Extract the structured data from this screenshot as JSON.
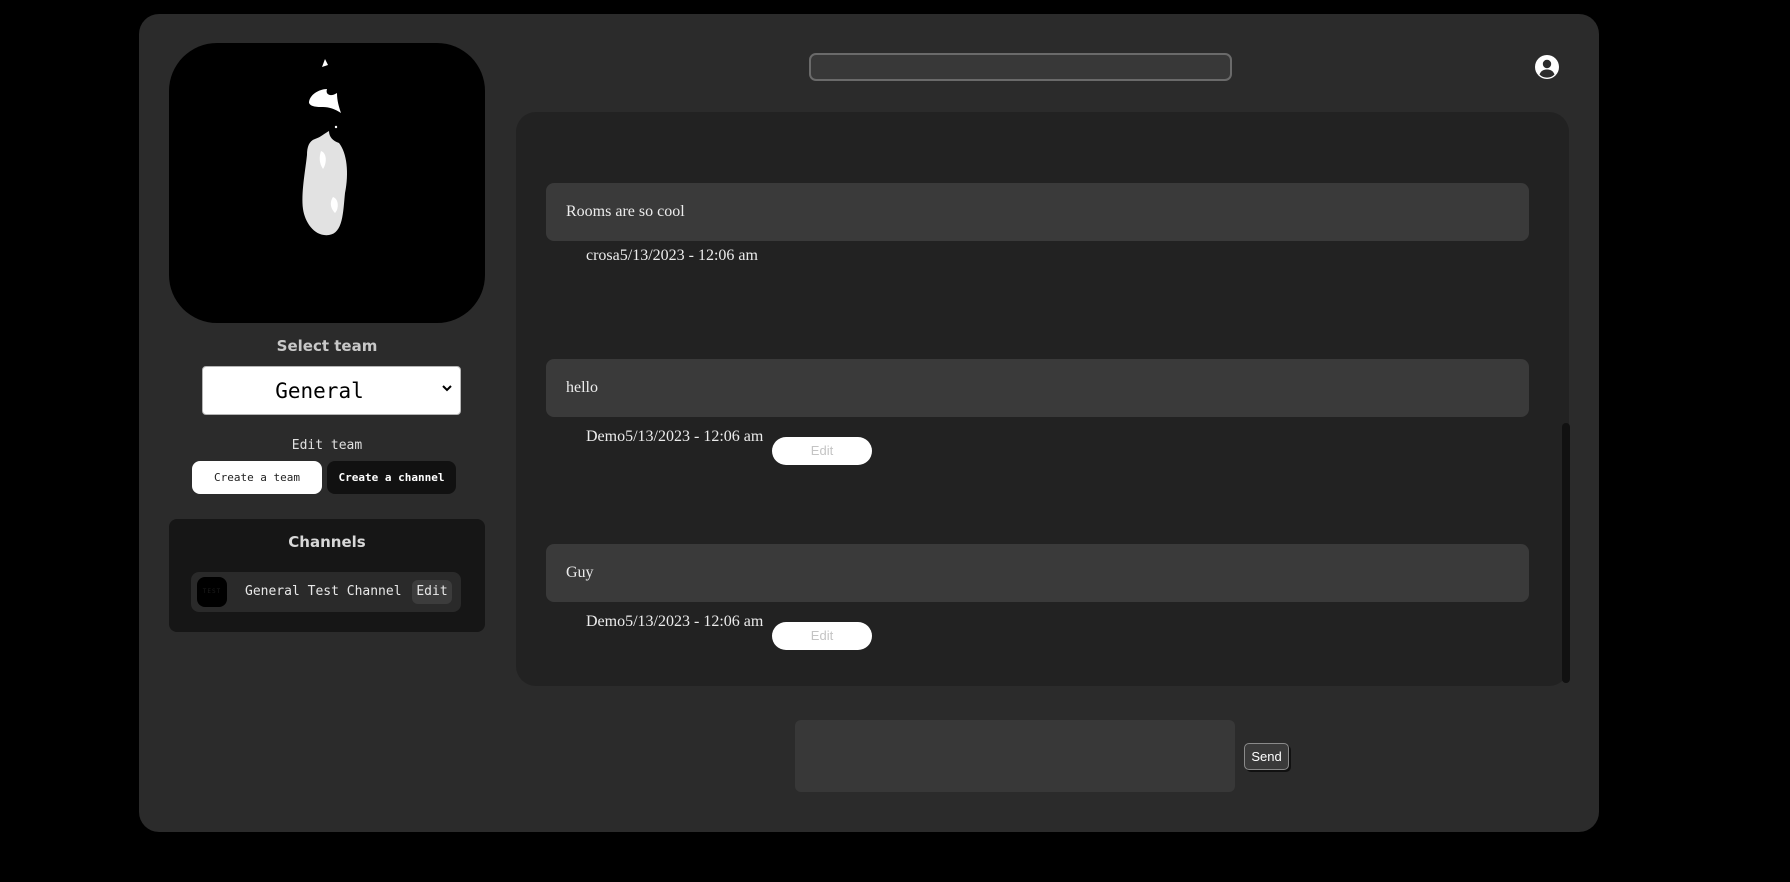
{
  "sidebar": {
    "logo_icon": "flame-logo",
    "select_team_label": "Select team",
    "team_select": {
      "selected": "General"
    },
    "edit_team_label": "Edit team",
    "create_team_label": "Create a team",
    "create_channel_label": "Create a channel",
    "channels": {
      "title": "Channels",
      "items": [
        {
          "avatar_text": "TEST",
          "name": "General Test Channel",
          "edit_label": "Edit"
        }
      ]
    }
  },
  "header": {
    "search": {
      "value": "",
      "placeholder": ""
    },
    "user_icon": "user-circle-icon"
  },
  "messages": [
    {
      "text": "Rooms are so cool",
      "author": "crosa",
      "timestamp": "5/13/2023 - 12:06 am",
      "edit_label": ""
    },
    {
      "text": "hello",
      "author": "Demo",
      "timestamp": "5/13/2023 - 12:06 am",
      "edit_label": "Edit"
    },
    {
      "text": "Guy",
      "author": "Demo",
      "timestamp": "5/13/2023 - 12:06 am",
      "edit_label": "Edit"
    }
  ],
  "composer": {
    "value": "",
    "send_label": "Send"
  },
  "colors": {
    "page_bg": "#000000",
    "app_bg": "#2b2b2b",
    "panel_bg": "#222222",
    "bubble_bg": "#3a3a3a",
    "text": "#ececec"
  }
}
